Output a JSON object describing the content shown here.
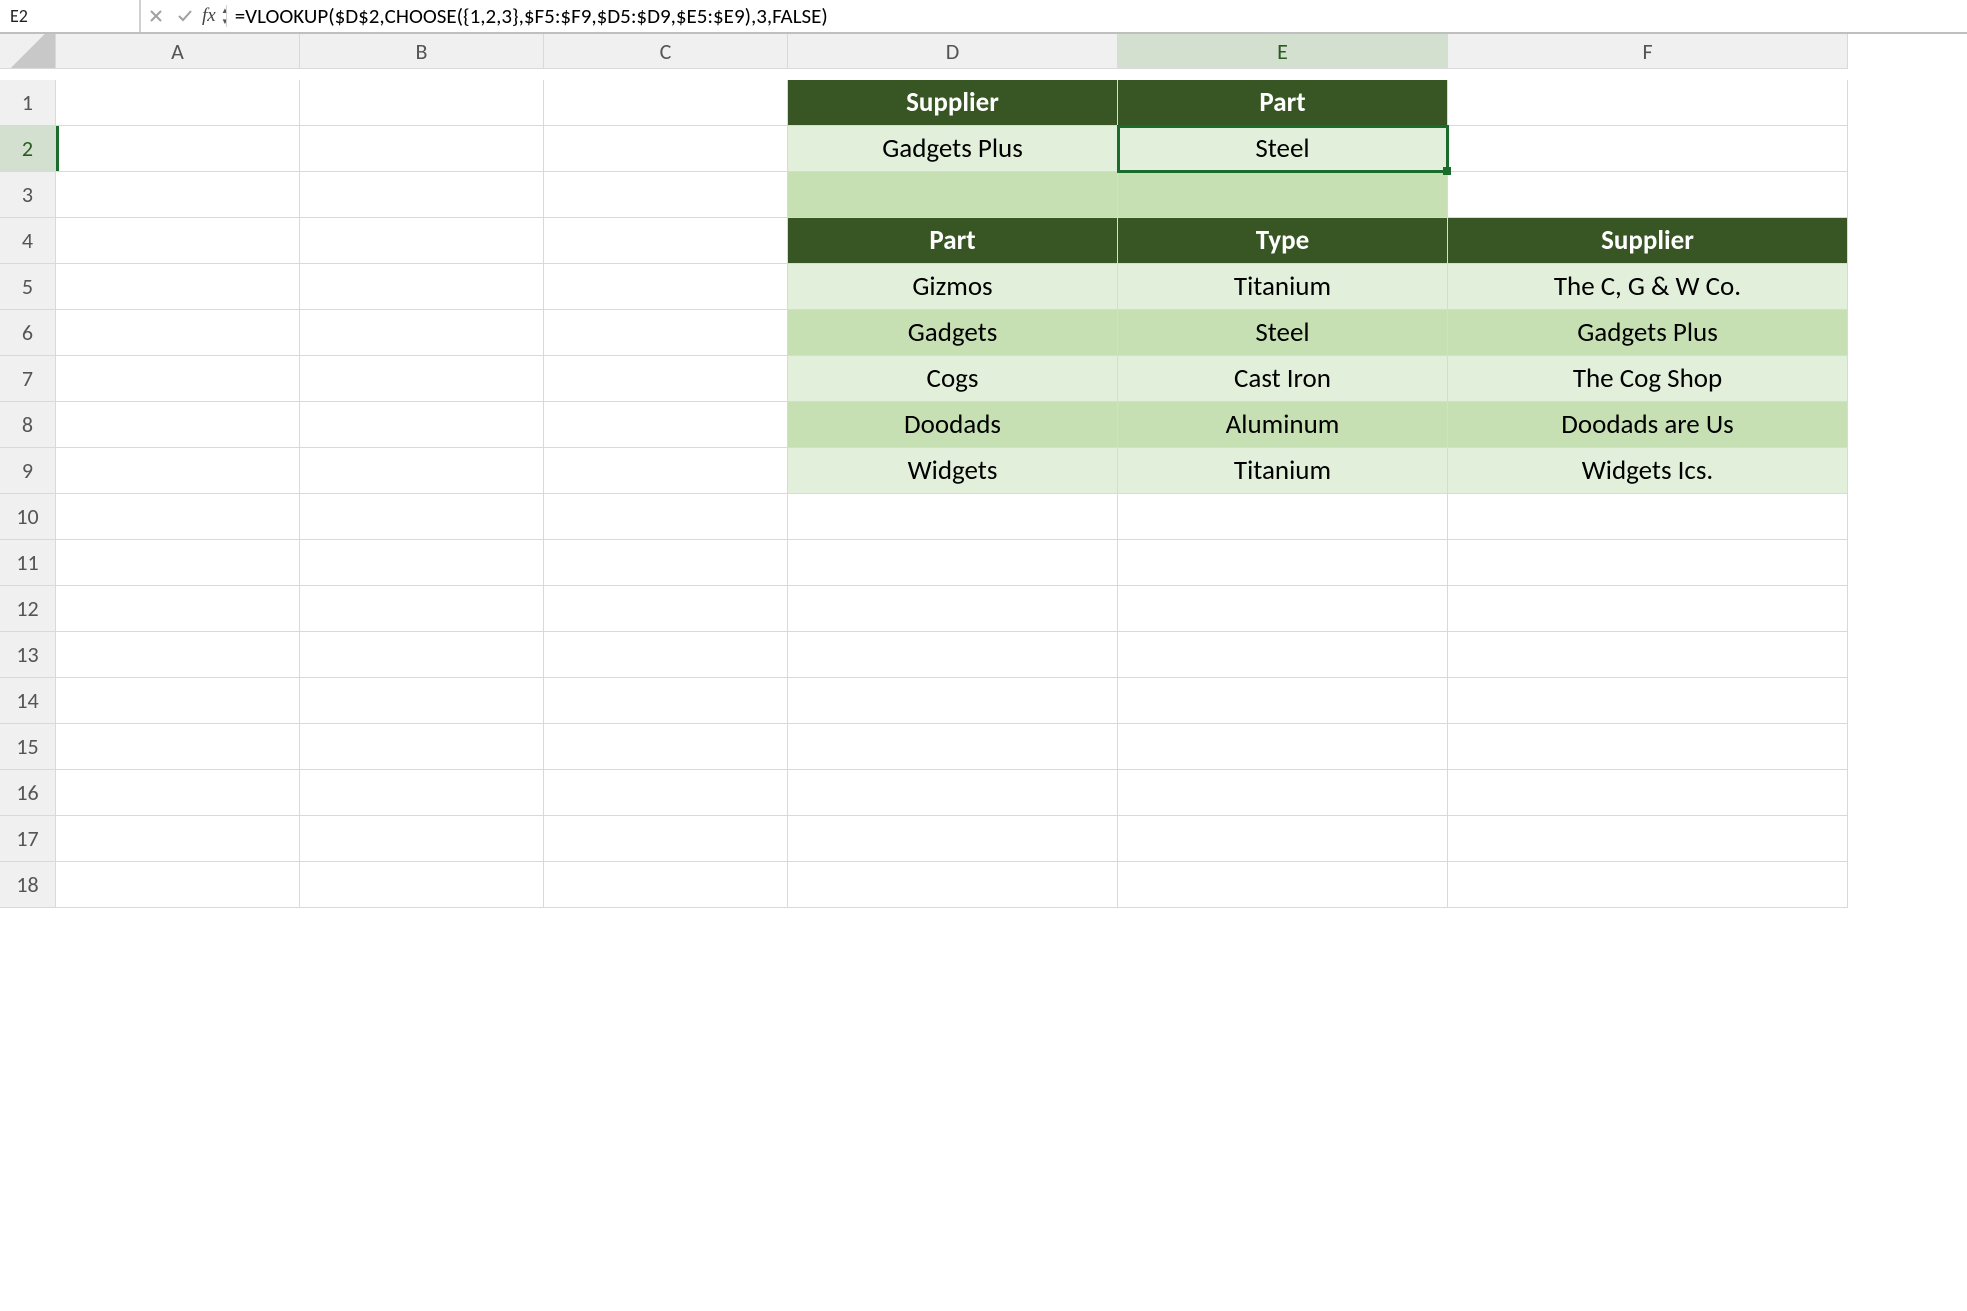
{
  "formulaBar": {
    "nameBox": "E2",
    "formula": "=VLOOKUP($D$2,CHOOSE({1,2,3},$F5:$F9,$D5:$D9,$E5:$E9),3,FALSE)",
    "fxLabel": "fx"
  },
  "columns": [
    "A",
    "B",
    "C",
    "D",
    "E",
    "F"
  ],
  "rowCount": 18,
  "activeCell": {
    "row": 2,
    "col": "E"
  },
  "lookup": {
    "headers": {
      "supplier": "Supplier",
      "part": "Part"
    },
    "values": {
      "supplier": "Gadgets Plus",
      "part": "Steel"
    }
  },
  "table": {
    "headers": {
      "part": "Part",
      "type": "Type",
      "supplier": "Supplier"
    },
    "rows": [
      {
        "part": "Gizmos",
        "type": "Titanium",
        "supplier": "The C, G & W Co."
      },
      {
        "part": "Gadgets",
        "type": "Steel",
        "supplier": "Gadgets Plus"
      },
      {
        "part": "Cogs",
        "type": "Cast Iron",
        "supplier": "The Cog Shop"
      },
      {
        "part": "Doodads",
        "type": "Aluminum",
        "supplier": "Doodads are Us"
      },
      {
        "part": "Widgets",
        "type": "Titanium",
        "supplier": "Widgets Ics."
      }
    ]
  }
}
